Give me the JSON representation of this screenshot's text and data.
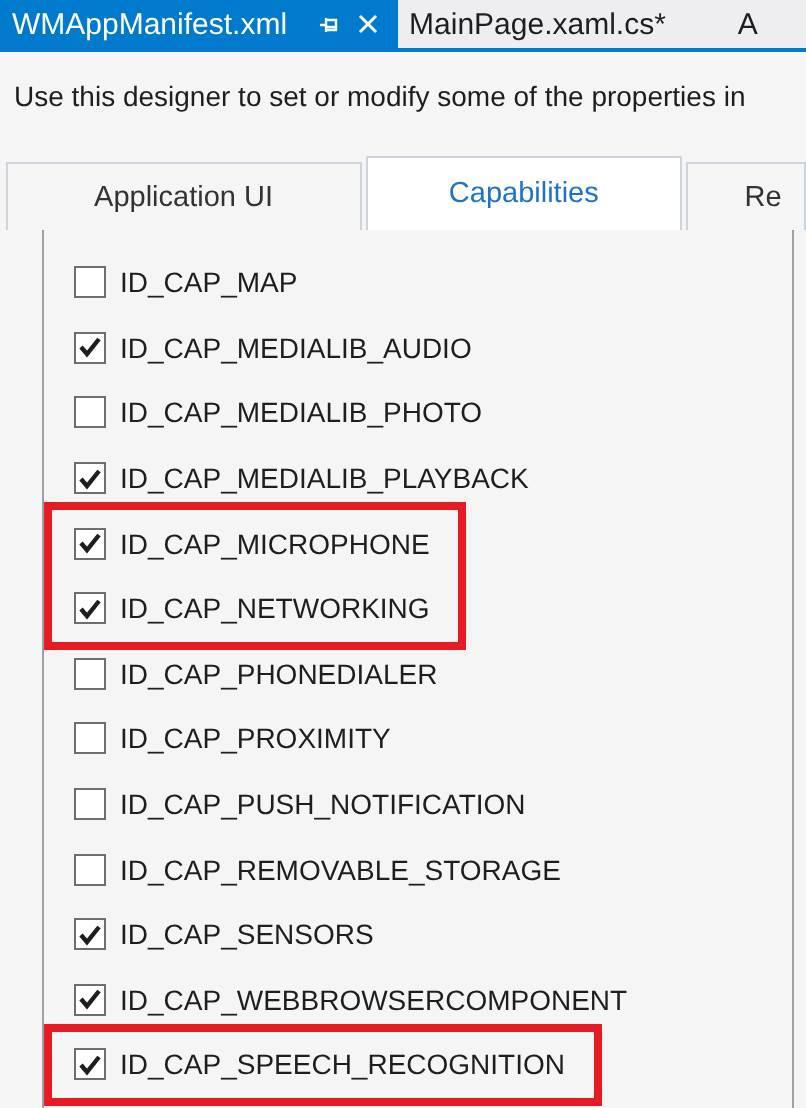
{
  "document_tabs": [
    {
      "label": "WMAppManifest.xml",
      "selected": true,
      "pinnable": true,
      "closable": true
    },
    {
      "label": "MainPage.xaml.cs*",
      "selected": false,
      "pinnable": false,
      "closable": false
    },
    {
      "label": "A",
      "selected": false,
      "pinnable": false,
      "closable": false
    }
  ],
  "description": "Use this designer to set or modify some of the properties in",
  "tabs": [
    {
      "label": "Application UI",
      "selected": false
    },
    {
      "label": "Capabilities",
      "selected": true
    },
    {
      "label": "Re",
      "selected": false
    }
  ],
  "capabilities": [
    {
      "label": "ID_CAP_MAP",
      "checked": false,
      "highlighted": false
    },
    {
      "label": "ID_CAP_MEDIALIB_AUDIO",
      "checked": true,
      "highlighted": false
    },
    {
      "label": "ID_CAP_MEDIALIB_PHOTO",
      "checked": false,
      "highlighted": false
    },
    {
      "label": "ID_CAP_MEDIALIB_PLAYBACK",
      "checked": true,
      "highlighted": false
    },
    {
      "label": "ID_CAP_MICROPHONE",
      "checked": true,
      "highlighted": true
    },
    {
      "label": "ID_CAP_NETWORKING",
      "checked": true,
      "highlighted": true
    },
    {
      "label": "ID_CAP_PHONEDIALER",
      "checked": false,
      "highlighted": false
    },
    {
      "label": "ID_CAP_PROXIMITY",
      "checked": false,
      "highlighted": false
    },
    {
      "label": "ID_CAP_PUSH_NOTIFICATION",
      "checked": false,
      "highlighted": false
    },
    {
      "label": "ID_CAP_REMOVABLE_STORAGE",
      "checked": false,
      "highlighted": false
    },
    {
      "label": "ID_CAP_SENSORS",
      "checked": true,
      "highlighted": false
    },
    {
      "label": "ID_CAP_WEBBROWSERCOMPONENT",
      "checked": true,
      "highlighted": false
    },
    {
      "label": "ID_CAP_SPEECH_RECOGNITION",
      "checked": true,
      "highlighted": true
    }
  ]
}
